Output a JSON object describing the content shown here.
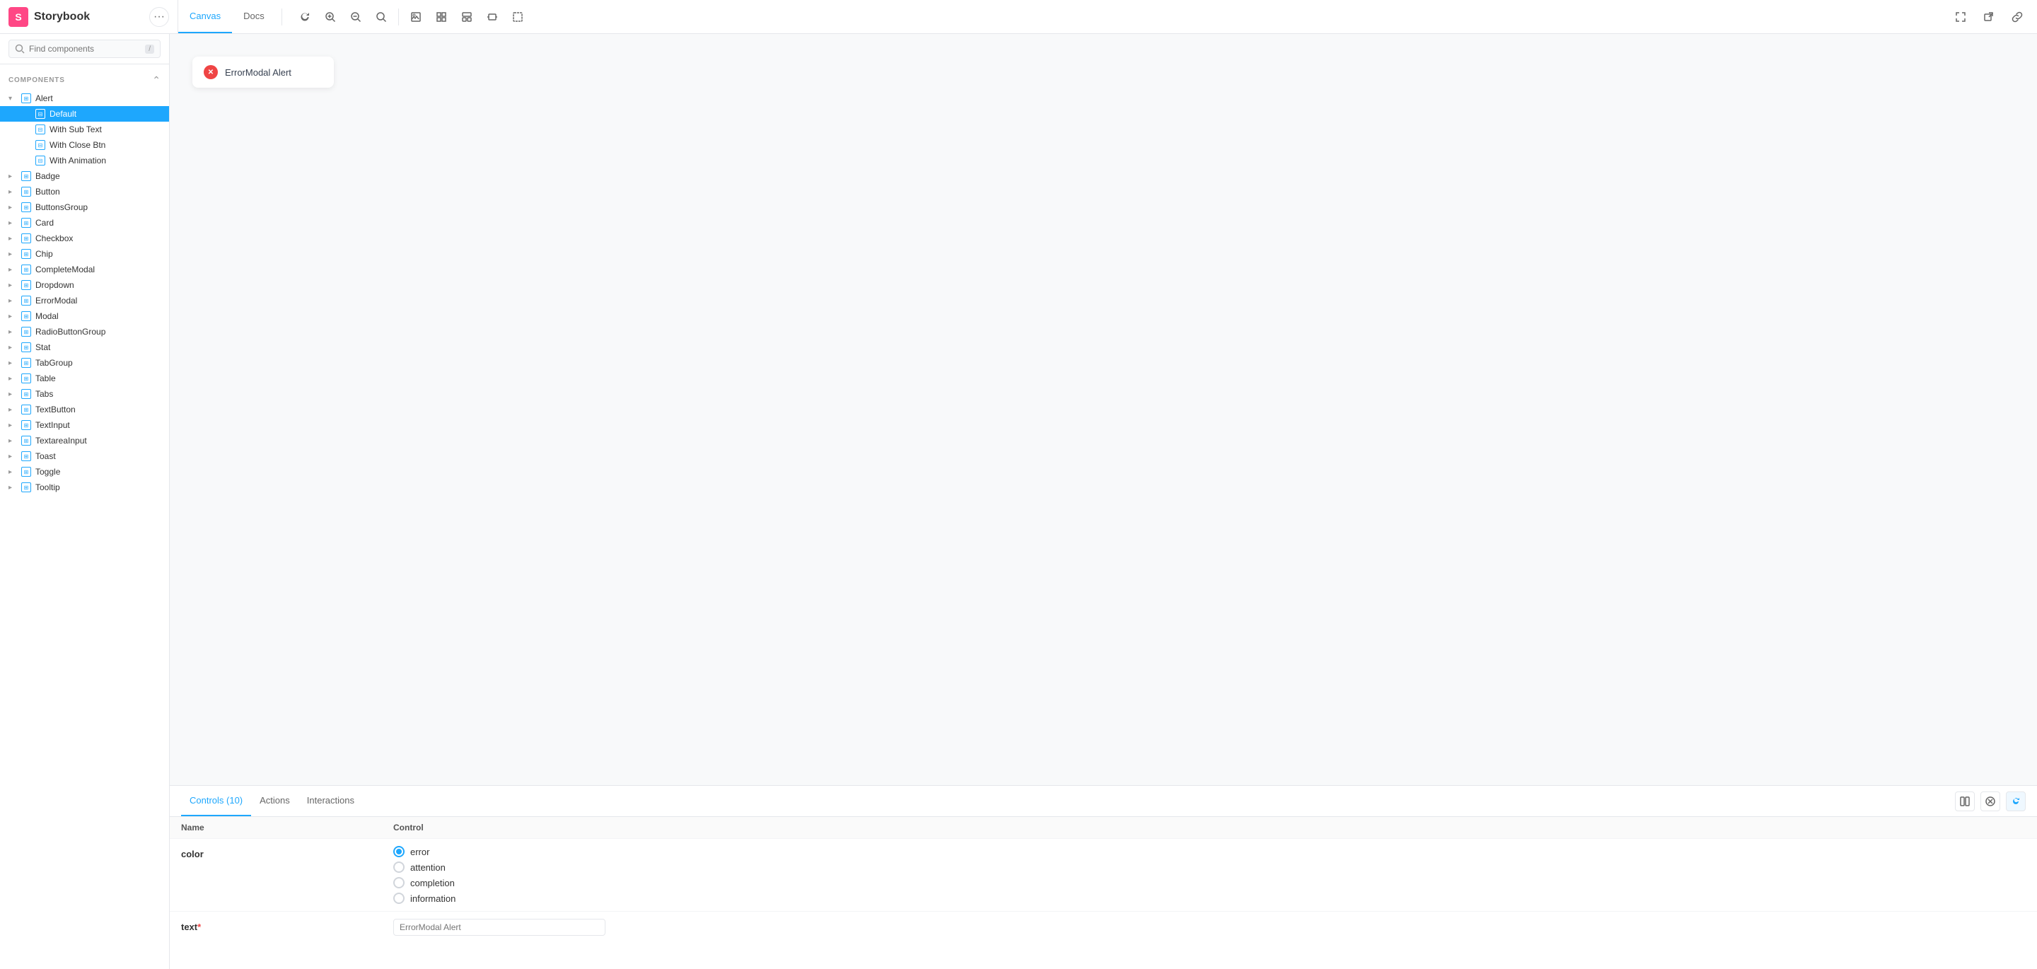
{
  "topbar": {
    "logo_text": "Storybook",
    "tabs": [
      {
        "label": "Canvas",
        "active": true
      },
      {
        "label": "Docs",
        "active": false
      }
    ],
    "toolbar_icons": [
      "↺",
      "🔍+",
      "🔍-",
      "🔍",
      "|",
      "⊞",
      "⊟",
      "▭",
      "⌨",
      "⊡"
    ],
    "right_icons": [
      "⤢",
      "⧉",
      "🔗"
    ]
  },
  "sidebar": {
    "search_placeholder": "Find components",
    "search_shortcut": "/",
    "section_label": "COMPONENTS",
    "components": [
      {
        "label": "Alert",
        "expanded": true,
        "level": 0
      },
      {
        "label": "Default",
        "level": 1,
        "active": true
      },
      {
        "label": "With Sub Text",
        "level": 2
      },
      {
        "label": "With Close Btn",
        "level": 2
      },
      {
        "label": "With Animation",
        "level": 2
      },
      {
        "label": "Badge",
        "level": 0
      },
      {
        "label": "Button",
        "level": 0
      },
      {
        "label": "ButtonsGroup",
        "level": 0
      },
      {
        "label": "Card",
        "level": 0
      },
      {
        "label": "Checkbox",
        "level": 0
      },
      {
        "label": "Chip",
        "level": 0
      },
      {
        "label": "CompleteModal",
        "level": 0
      },
      {
        "label": "Dropdown",
        "level": 0
      },
      {
        "label": "ErrorModal",
        "level": 0
      },
      {
        "label": "Modal",
        "level": 0
      },
      {
        "label": "RadioButtonGroup",
        "level": 0
      },
      {
        "label": "Stat",
        "level": 0
      },
      {
        "label": "TabGroup",
        "level": 0
      },
      {
        "label": "Table",
        "level": 0
      },
      {
        "label": "Tabs",
        "level": 0
      },
      {
        "label": "TextButton",
        "level": 0
      },
      {
        "label": "TextInput",
        "level": 0
      },
      {
        "label": "TextareaInput",
        "level": 0
      },
      {
        "label": "Toast",
        "level": 0
      },
      {
        "label": "Toggle",
        "level": 0
      },
      {
        "label": "Tooltip",
        "level": 0
      }
    ]
  },
  "canvas": {
    "alert_text": "ErrorModal Alert"
  },
  "bottom_panel": {
    "tabs": [
      {
        "label": "Controls (10)",
        "active": true
      },
      {
        "label": "Actions",
        "active": false
      },
      {
        "label": "Interactions",
        "active": false
      }
    ],
    "controls": [
      {
        "name": "color",
        "required": false,
        "options": [
          {
            "value": "error",
            "selected": true
          },
          {
            "value": "attention",
            "selected": false
          },
          {
            "value": "completion",
            "selected": false
          },
          {
            "value": "information",
            "selected": false
          }
        ]
      },
      {
        "name": "text",
        "required": true,
        "placeholder": "ErrorModal Alert"
      }
    ]
  }
}
